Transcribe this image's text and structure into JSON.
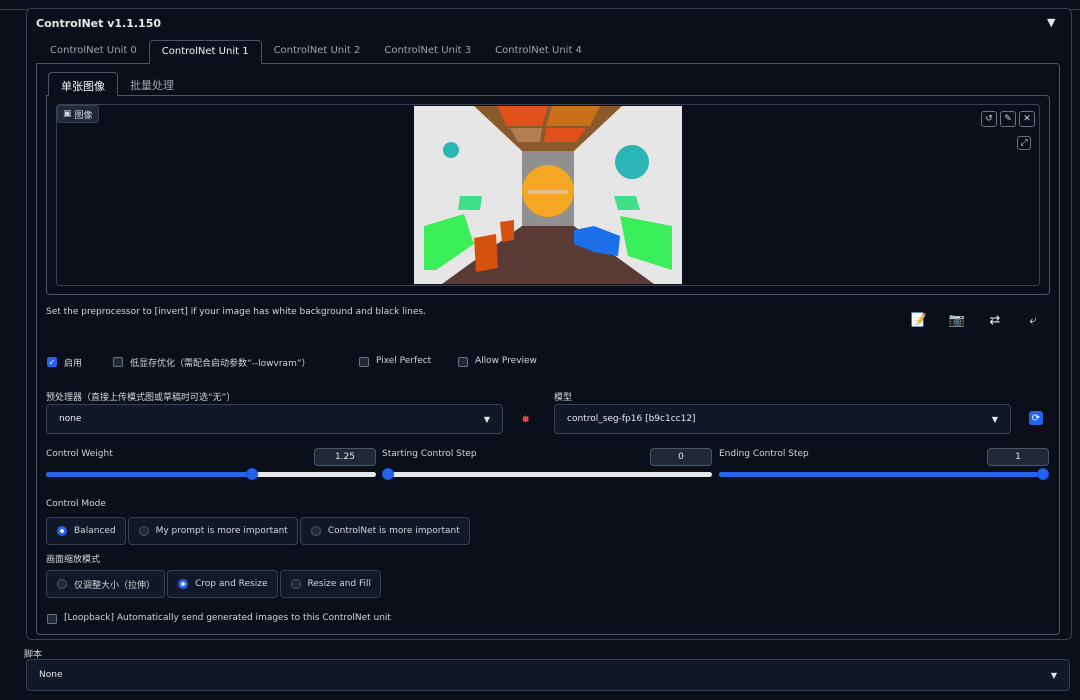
{
  "header": {
    "title": "ControlNet v1.1.150",
    "toggle": "▼"
  },
  "unit_tabs": [
    "ControlNet Unit 0",
    "ControlNet Unit 1",
    "ControlNet Unit 2",
    "ControlNet Unit 3",
    "ControlNet Unit 4"
  ],
  "unit_tab_active": 1,
  "sub_tabs": [
    "单张图像",
    "批量处理"
  ],
  "image_panel": {
    "label": "图像",
    "buttons": [
      "↺",
      "✎",
      "✕"
    ],
    "extra_button": "⤢"
  },
  "hint": "Set the preprocessor to [invert] if your image has white background and black lines.",
  "tools": [
    "📝",
    "📷",
    "⇄",
    "⤶"
  ],
  "checkboxes": [
    {
      "label": "启用",
      "checked": true
    },
    {
      "label": "低显存优化（需配合启动参数“--lowvram”）",
      "checked": false
    },
    {
      "label": "Pixel Perfect",
      "checked": false
    },
    {
      "label": "Allow Preview",
      "checked": false
    }
  ],
  "preprocessor": {
    "label": "预处理器（直接上传模式图或草稿时可选“无”）",
    "value": "none",
    "run_icon": "✸"
  },
  "model": {
    "label": "模型",
    "value": "control_seg-fp16 [b9c1cc12]",
    "refresh_icon": "⟳"
  },
  "sliders": [
    {
      "label": "Control Weight",
      "value": "1.25",
      "fraction": 0.625
    },
    {
      "label": "Starting Control Step",
      "value": "0",
      "fraction": 0.0
    },
    {
      "label": "Ending Control Step",
      "value": "1",
      "fraction": 1.0
    }
  ],
  "control_mode": {
    "label": "Control Mode",
    "options": [
      "Balanced",
      "My prompt is more important",
      "ControlNet is more important"
    ],
    "selected": 0
  },
  "resize_mode": {
    "label": "画面缩放模式",
    "options": [
      "仅调整大小（拉伸）",
      "Crop and Resize",
      "Resize and Fill"
    ],
    "selected": 1
  },
  "loopback": {
    "label": "[Loopback] Automatically send generated images to this ControlNet unit",
    "checked": false
  },
  "script": {
    "label": "脚本",
    "value": "None"
  },
  "colors": {
    "background": "#0b0f19",
    "accent": "#2563eb",
    "border": "#374151"
  }
}
